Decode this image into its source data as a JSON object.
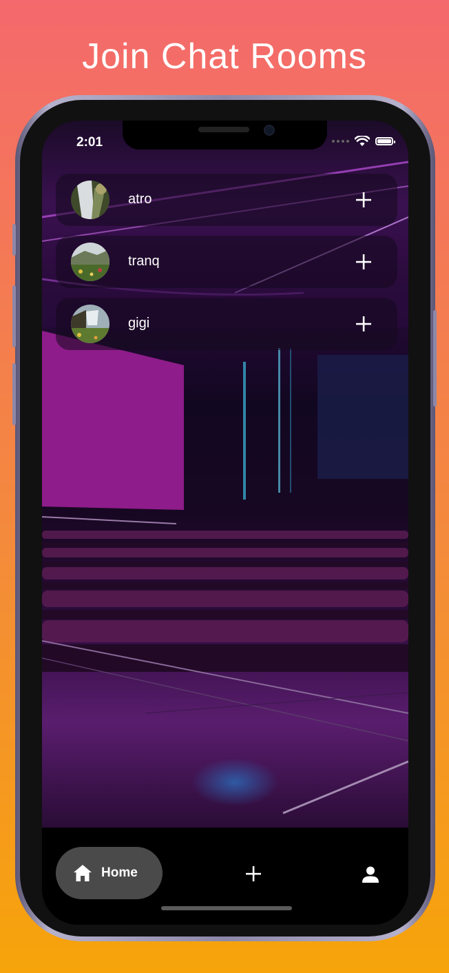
{
  "headline": "Join Chat Rooms",
  "status_bar": {
    "time": "2:01"
  },
  "rooms": [
    {
      "name": "atro",
      "avatar": "waterfall-avatar"
    },
    {
      "name": "tranq",
      "avatar": "valley-avatar"
    },
    {
      "name": "gigi",
      "avatar": "cliff-avatar"
    }
  ],
  "bottom_nav": {
    "home_label": "Home",
    "add_icon": "plus-icon",
    "profile_icon": "person-icon"
  },
  "colors": {
    "gradient_top": "#f4696d",
    "gradient_bottom": "#f6a40a",
    "accent_purple": "#8e1c8a",
    "nav_pill": "#4a4a4a"
  }
}
